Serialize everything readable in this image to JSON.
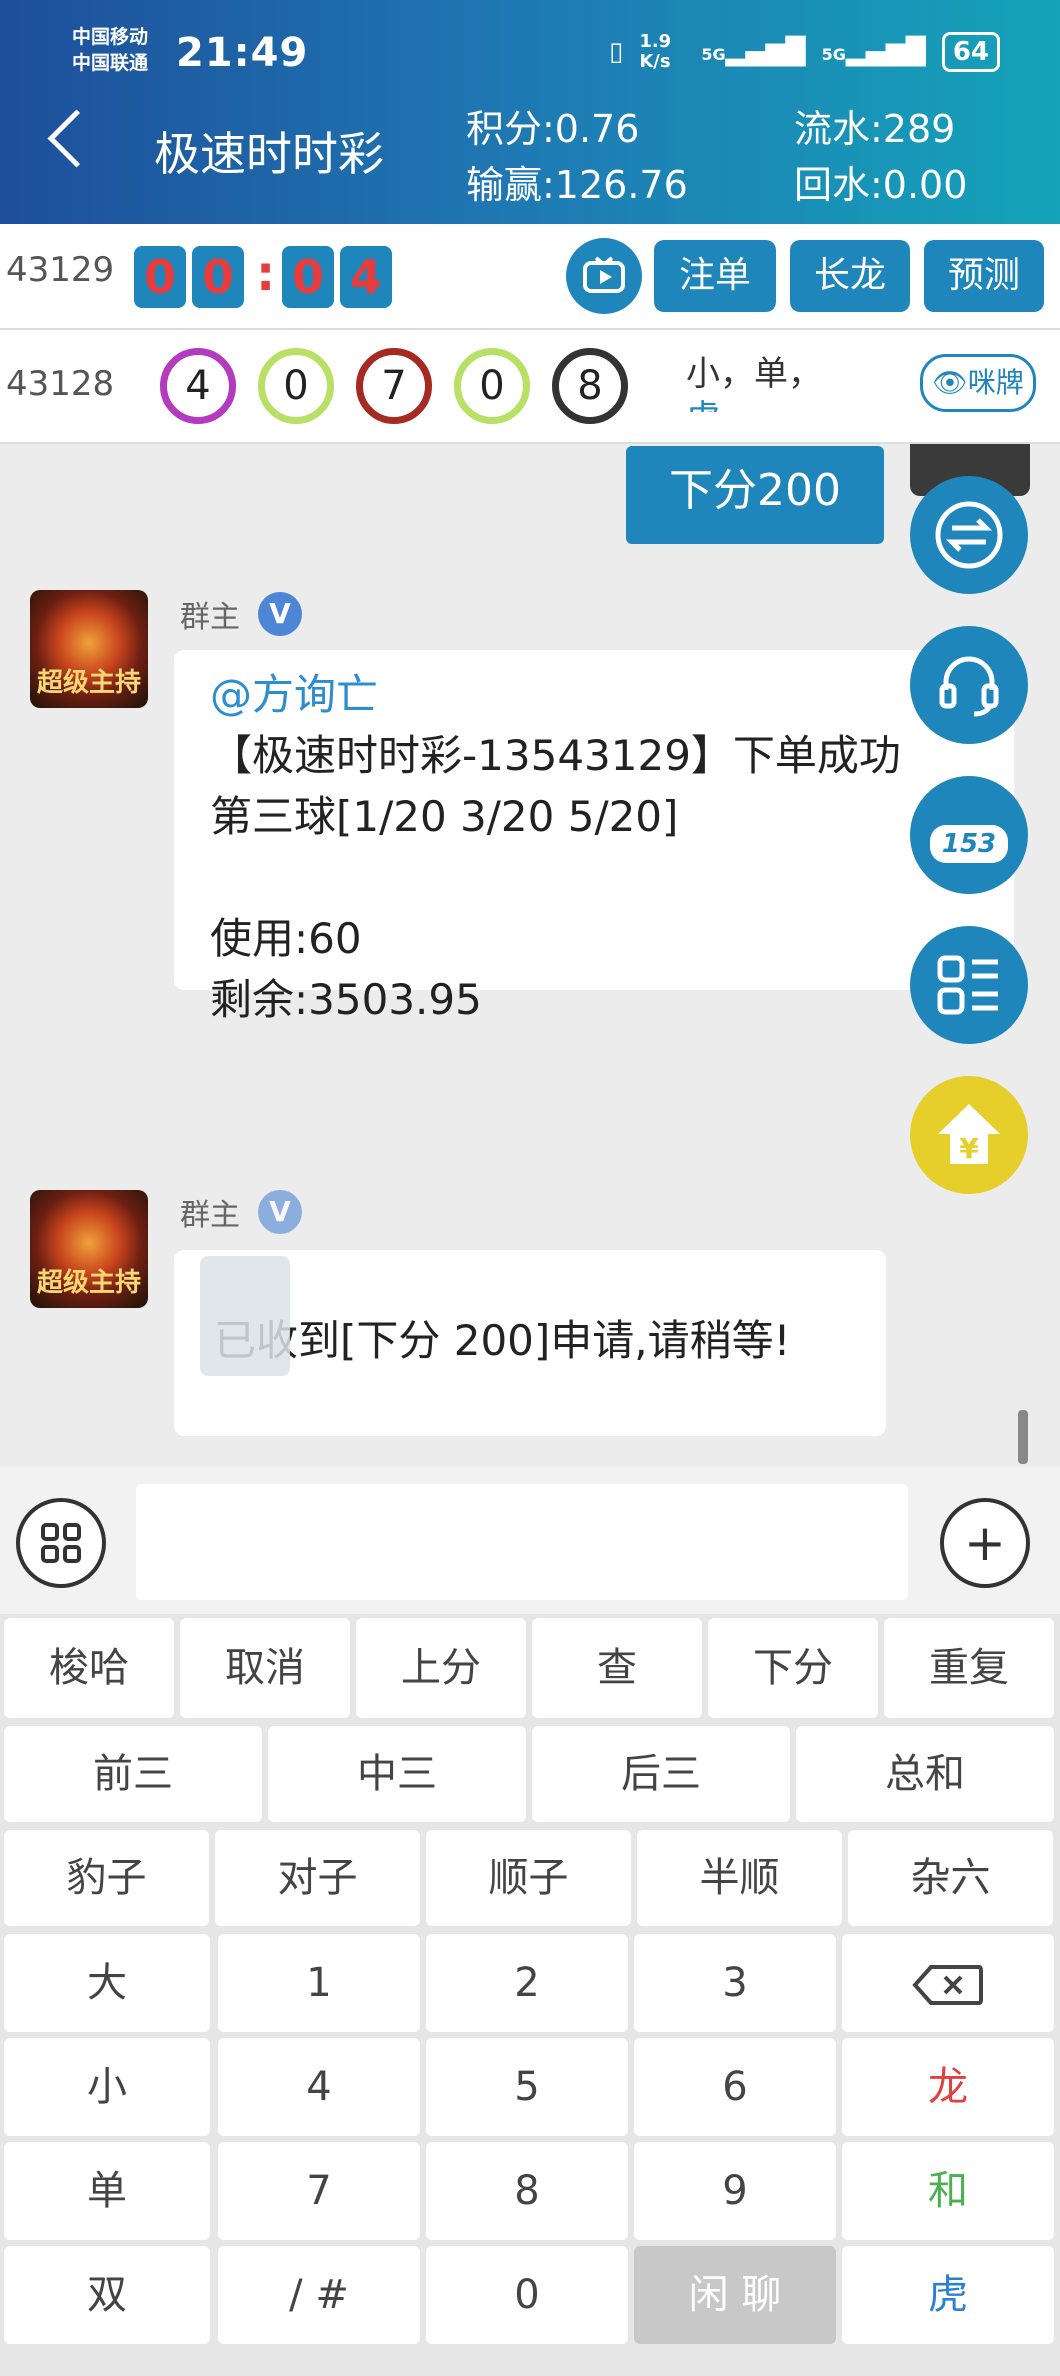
{
  "status_bar": {
    "carrier_1": "中国移动",
    "carrier_2": "中国联通",
    "time": "21:49",
    "net_speed": "1.9 K/s",
    "net_type": "5G",
    "battery": "64"
  },
  "header": {
    "title": "极速时时彩",
    "points_label": "积分:0.76",
    "winloss_label": "输赢:126.76",
    "turnover_label": "流水:289",
    "rebate_label": "回水:0.00"
  },
  "current_period": {
    "number": "43129",
    "countdown": [
      "0",
      "0",
      "0",
      "4"
    ],
    "colon": ":",
    "buttons": {
      "bet": "注单",
      "long_dragon": "长龙",
      "predict": "预测"
    }
  },
  "last_result": {
    "period": "43128",
    "balls": [
      {
        "value": "4",
        "color": "#b43bbd"
      },
      {
        "value": "0",
        "color": "#b7e064"
      },
      {
        "value": "7",
        "color": "#a52a22"
      },
      {
        "value": "0",
        "color": "#b7e064"
      },
      {
        "value": "8",
        "color": "#333333"
      }
    ],
    "summary_line1": "小，单，",
    "summary_line2": "虎",
    "peek_label": "咪牌"
  },
  "chat": {
    "my_message": "下分200",
    "messages": [
      {
        "sender": "群主",
        "verified_badge": "V",
        "avatar_text": "超级主持",
        "mention": "@方询亡",
        "lines": [
          "【极速时时彩-13543129】下单成功",
          "第三球[1/20  3/20  5/20]",
          "",
          "使用:60",
          "剩余:3503.95"
        ]
      },
      {
        "sender": "群主",
        "verified_badge": "V",
        "avatar_text": "超级主持",
        "text": "已收到[下分 200]申请,请稍等!"
      }
    ]
  },
  "side_fabs": [
    "exchange-icon",
    "headset-icon",
    "153-icon",
    "menu-list-icon",
    "yuan-home-icon"
  ],
  "side_fab_153_label": "153",
  "keyboard": {
    "row1": [
      "梭哈",
      "取消",
      "上分",
      "查",
      "下分",
      "重复"
    ],
    "row2": [
      "前三",
      "中三",
      "后三",
      "总和"
    ],
    "row3": [
      "豹子",
      "对子",
      "顺子",
      "半顺",
      "杂六"
    ],
    "col1": [
      "大",
      "小",
      "单",
      "双"
    ],
    "digits": [
      "1",
      "2",
      "3",
      "4",
      "5",
      "6",
      "7",
      "8",
      "9",
      "/ #",
      "0"
    ],
    "chat_key": "闲 聊",
    "right_col": [
      "龙",
      "和",
      "虎"
    ],
    "colors": {
      "long": "#e04040",
      "he": "#4caf50",
      "hu": "#2d7fd3"
    }
  }
}
